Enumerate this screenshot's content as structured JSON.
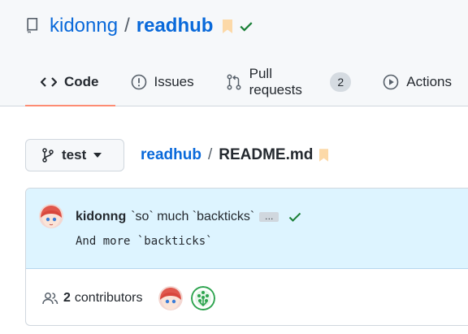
{
  "repo": {
    "owner": "kidonng",
    "separator": "/",
    "name": "readhub"
  },
  "tabs": [
    {
      "label": "Code",
      "icon": "code-icon",
      "active": true
    },
    {
      "label": "Issues",
      "icon": "issue-opened-icon"
    },
    {
      "label": "Pull requests",
      "icon": "git-pull-request-icon",
      "count": "2"
    },
    {
      "label": "Actions",
      "icon": "play-icon"
    }
  ],
  "branch": {
    "name": "test",
    "icon": "git-branch-icon"
  },
  "breadcrumb": {
    "repo": "readhub",
    "separator": "/",
    "file": "README.md"
  },
  "commit": {
    "author": "kidonng",
    "message": "`so` much `backticks`",
    "ellipsis": "…",
    "description": "And more `backticks`"
  },
  "contributors": {
    "count": "2",
    "label": "contributors"
  },
  "colors": {
    "link": "#0969da",
    "accent_underline": "#fd8c73",
    "success": "#1a7f37",
    "bookmark": "#fcd9a8",
    "commit_bg": "#ddf4ff"
  }
}
